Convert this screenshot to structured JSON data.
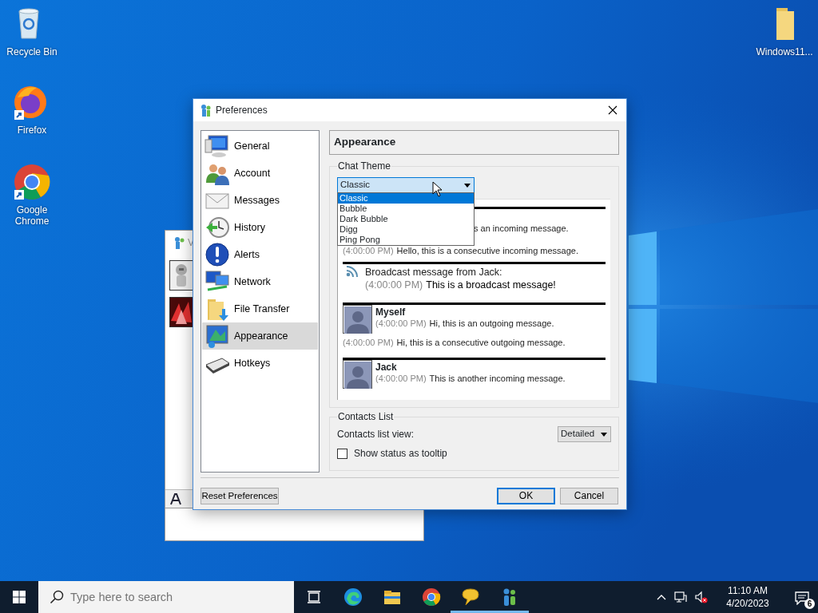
{
  "desktop_icons": [
    {
      "kind": "recycle",
      "label": "Recycle Bin"
    },
    {
      "kind": "firefox",
      "label": "Firefox"
    },
    {
      "kind": "chrome",
      "label": "Google Chrome"
    },
    {
      "kind": "folder",
      "label": "Windows11..."
    }
  ],
  "background_window": {
    "title": "V"
  },
  "dialog": {
    "title": "Preferences",
    "categories": [
      {
        "kind": "general",
        "label": "General",
        "selected": false
      },
      {
        "kind": "account",
        "label": "Account",
        "selected": false
      },
      {
        "kind": "messages",
        "label": "Messages",
        "selected": false
      },
      {
        "kind": "history",
        "label": "History",
        "selected": false
      },
      {
        "kind": "alerts",
        "label": "Alerts",
        "selected": false
      },
      {
        "kind": "network",
        "label": "Network",
        "selected": false
      },
      {
        "kind": "filetransfer",
        "label": "File Transfer",
        "selected": false
      },
      {
        "kind": "appearance",
        "label": "Appearance",
        "selected": true
      },
      {
        "kind": "hotkeys",
        "label": "Hotkeys",
        "selected": false
      }
    ],
    "panel_title": "Appearance",
    "chat_theme": {
      "legend": "Chat Theme",
      "value": "Classic",
      "expanded": true,
      "options": [
        {
          "label": "Classic",
          "selected": true
        },
        {
          "label": "Bubble",
          "selected": false
        },
        {
          "label": "Dark Bubble",
          "selected": false
        },
        {
          "label": "Digg",
          "selected": false
        },
        {
          "label": "Ping Pong",
          "selected": false
        }
      ]
    },
    "preview": [
      {
        "kind": "fragment",
        "text": "s an incoming message."
      },
      {
        "kind": "continuation",
        "time": "(4:00:00 PM)",
        "text": "Hello, this is a consecutive incoming message."
      },
      {
        "kind": "broadcast",
        "header": "Broadcast message from Jack:",
        "time": "(4:00:00 PM)",
        "text": "This is a broadcast message!"
      },
      {
        "kind": "message",
        "name": "Myself",
        "time": "(4:00:00 PM)",
        "text": "Hi, this is an outgoing message."
      },
      {
        "kind": "continuation",
        "time": "(4:00:00 PM)",
        "text": "Hi, this is a consecutive outgoing message."
      },
      {
        "kind": "message",
        "name": "Jack",
        "time": "(4:00:00 PM)",
        "text": "This is another incoming message."
      }
    ],
    "contacts": {
      "legend": "Contacts List",
      "view_label": "Contacts list view:",
      "view_value": "Detailed",
      "tooltip_label": "Show status as tooltip",
      "tooltip_checked": false
    },
    "buttons": {
      "reset": "Reset Preferences",
      "ok": "OK",
      "cancel": "Cancel"
    }
  },
  "taskbar": {
    "search_placeholder": "Type here to search",
    "apps": [
      {
        "kind": "taskview",
        "running": false
      },
      {
        "kind": "edge",
        "running": false
      },
      {
        "kind": "explorer",
        "running": false
      },
      {
        "kind": "chrome",
        "running": false
      },
      {
        "kind": "chat",
        "running": true
      },
      {
        "kind": "messenger",
        "running": true
      }
    ],
    "time": "11:10 AM",
    "date": "4/20/2023",
    "notifications": "6"
  }
}
